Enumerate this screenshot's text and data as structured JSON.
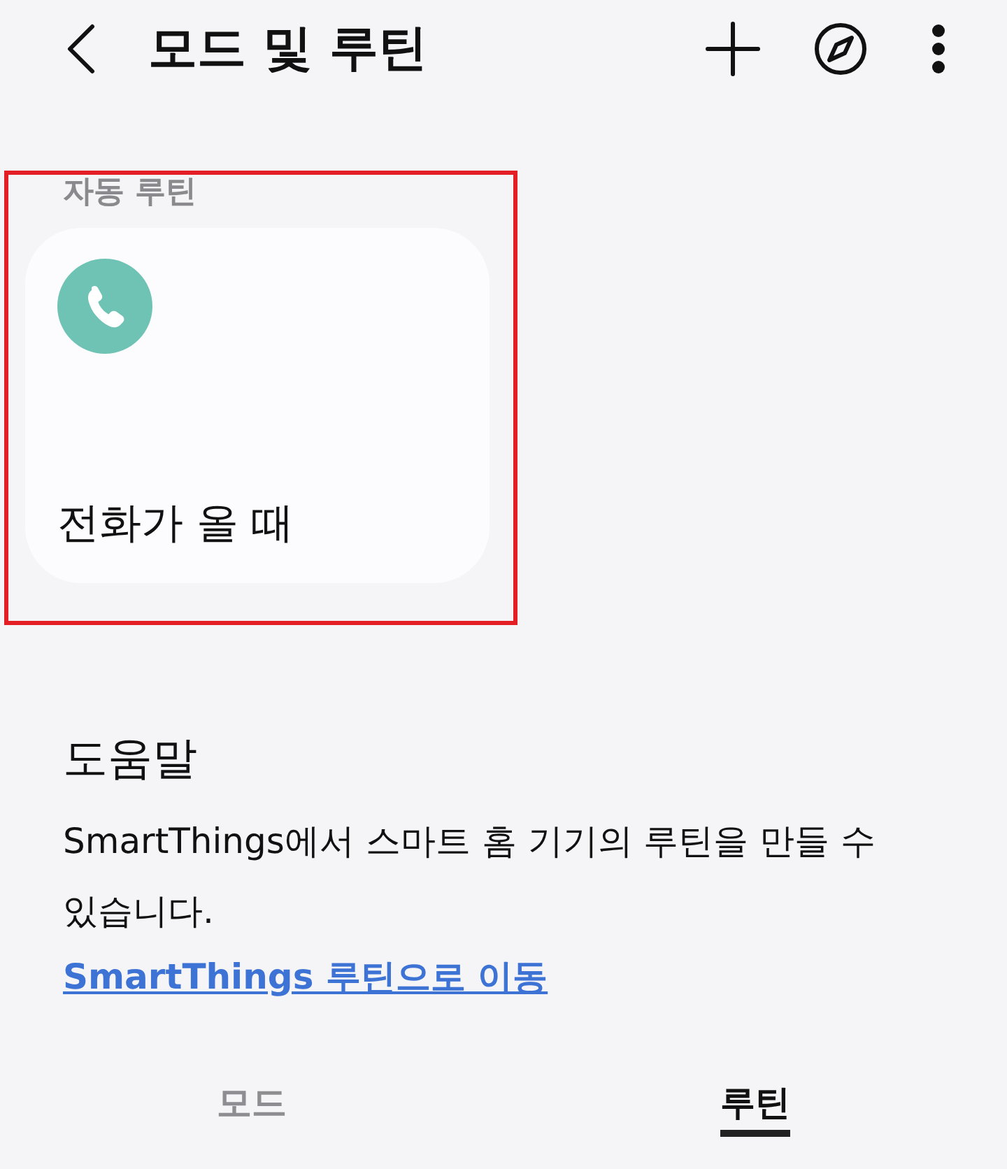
{
  "header": {
    "title": "모드 및 루틴"
  },
  "routine_section": {
    "highlighted": true,
    "label": "자동 루틴",
    "routines": [
      {
        "name": "전화가 올 때"
      }
    ]
  },
  "help": {
    "title": "도움말",
    "text": "SmartThings에서 스마트 홈 기기의 루틴을 만들 수 있습니다.",
    "link": "SmartThings 루틴으로 이동"
  },
  "tabs": [
    {
      "label": "모드",
      "selected": false
    },
    {
      "label": "루틴",
      "selected": true
    }
  ]
}
